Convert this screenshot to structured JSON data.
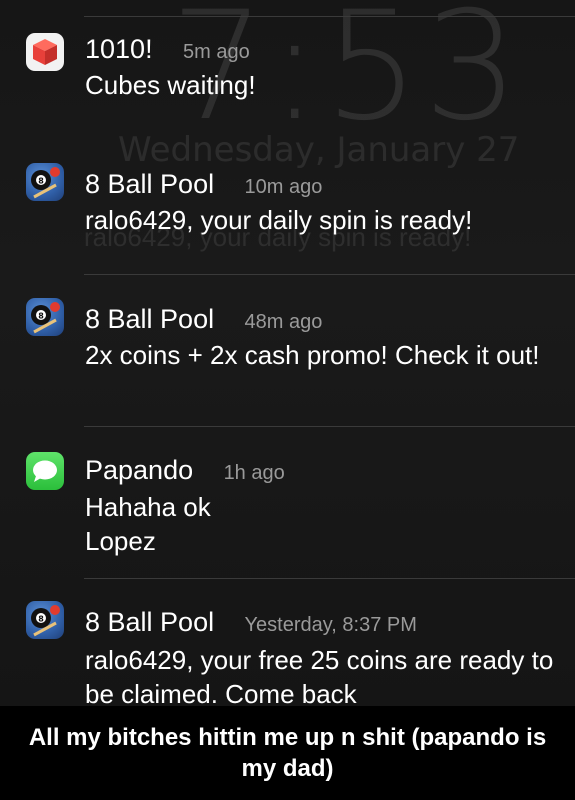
{
  "lockscreen": {
    "time": "7:53",
    "date": "Wednesday, January 27"
  },
  "notifications": [
    {
      "app": "1010!",
      "time": "5m ago",
      "message": "Cubes waiting!",
      "icon": "cube-icon"
    },
    {
      "app": "8 Ball Pool",
      "time": "10m ago",
      "message": "ralo6429, your daily spin is ready!",
      "icon": "8-ball-pool-icon"
    },
    {
      "app": "8 Ball Pool",
      "time": "48m ago",
      "message": "2x coins + 2x cash promo! Check it out!",
      "icon": "8-ball-pool-icon"
    },
    {
      "app": "Papando",
      "time": "1h ago",
      "message": "Hahaha ok\nLopez",
      "icon": "messages-icon"
    },
    {
      "app": "8 Ball Pool",
      "time": "Yesterday, 8:37 PM",
      "message": "ralo6429, your free 25 coins are ready to be claimed. Come back",
      "icon": "8-ball-pool-icon"
    }
  ],
  "caption": "All my bitches hittin me up n shit (papando is my dad)",
  "colors": {
    "background": "#000000",
    "text": "#ffffff",
    "timestamp": "#9a9a9a",
    "messages_green": "#2bbf3b",
    "cube_red": "#e8403a"
  }
}
